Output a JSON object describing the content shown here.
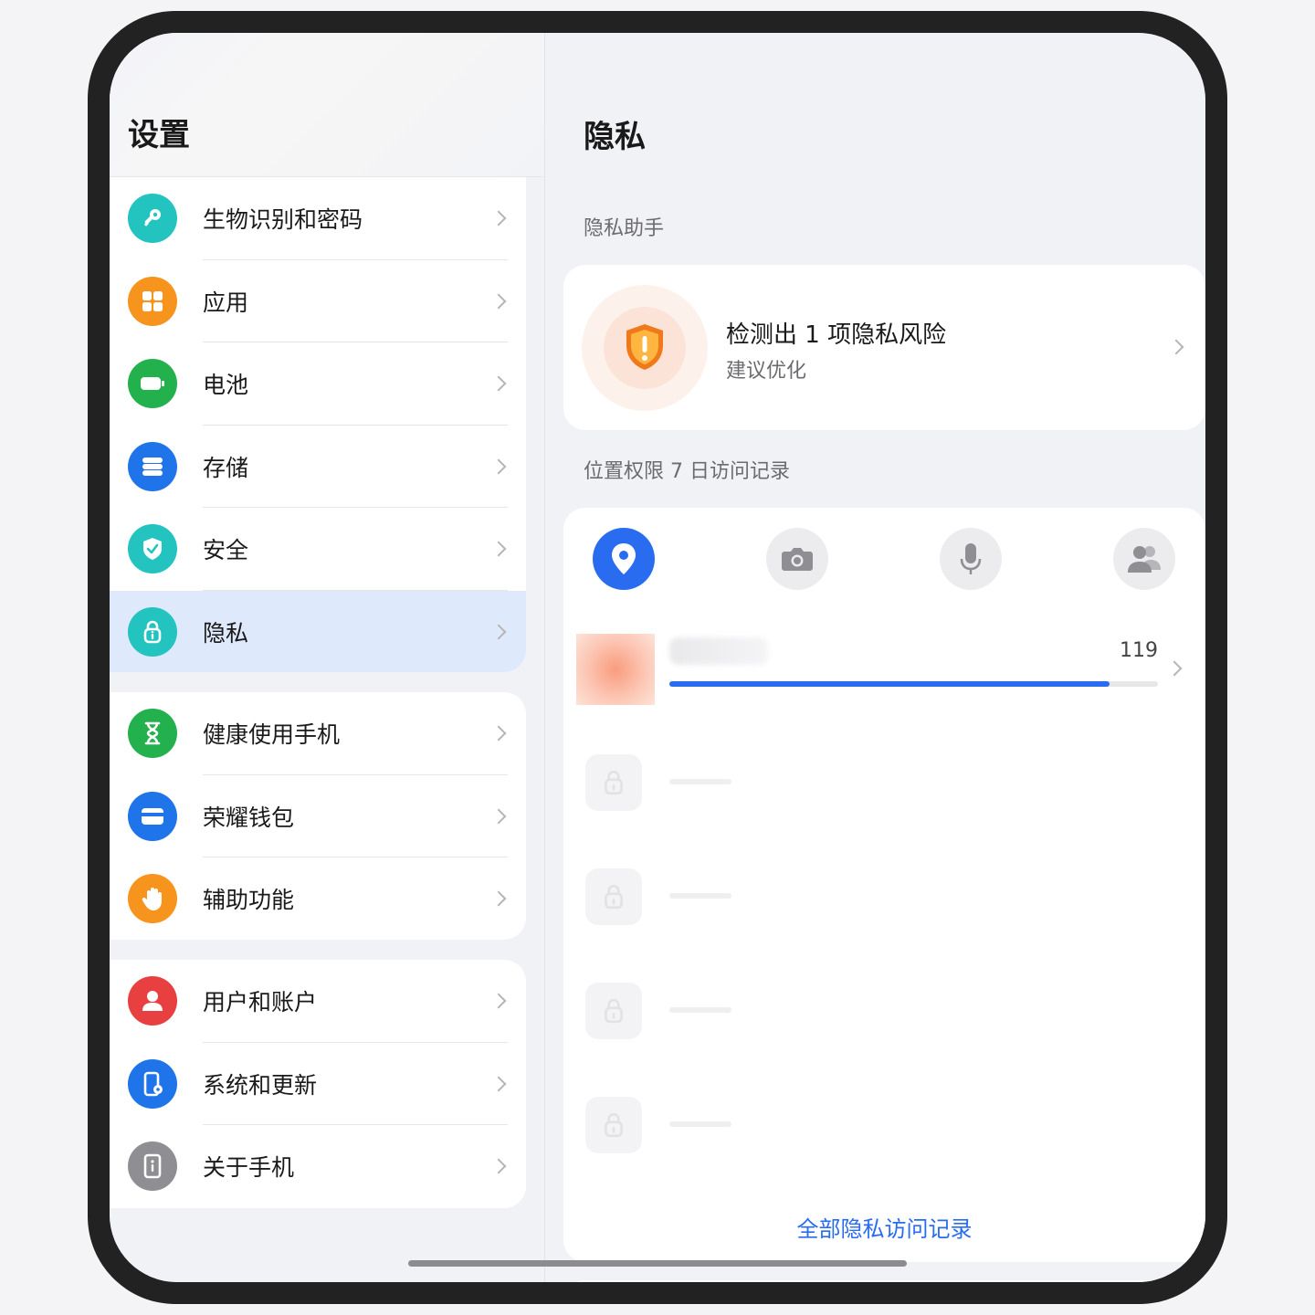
{
  "left": {
    "title": "设置",
    "group1": [
      {
        "label": "生物识别和密码",
        "icon": "key-icon",
        "color": "#23c3c0"
      },
      {
        "label": "应用",
        "icon": "apps-grid-icon",
        "color": "#f7941d"
      },
      {
        "label": "电池",
        "icon": "battery-icon",
        "color": "#22b14c"
      },
      {
        "label": "存储",
        "icon": "storage-icon",
        "color": "#1e74e8"
      },
      {
        "label": "安全",
        "icon": "shield-check-icon",
        "color": "#23c3c0"
      },
      {
        "label": "隐私",
        "icon": "privacy-lock-icon",
        "color": "#23c3c0",
        "selected": true
      }
    ],
    "group2": [
      {
        "label": "健康使用手机",
        "icon": "hourglass-icon",
        "color": "#22b14c"
      },
      {
        "label": "荣耀钱包",
        "icon": "wallet-icon",
        "color": "#1e74e8"
      },
      {
        "label": "辅助功能",
        "icon": "hand-icon",
        "color": "#f7941d"
      }
    ],
    "group3": [
      {
        "label": "用户和账户",
        "icon": "user-icon",
        "color": "#e84040"
      },
      {
        "label": "系统和更新",
        "icon": "phone-gear-icon",
        "color": "#1e74e8"
      },
      {
        "label": "关于手机",
        "icon": "info-phone-icon",
        "color": "#8e8e93"
      }
    ]
  },
  "right": {
    "title": "隐私",
    "assistant_label": "隐私助手",
    "risk": {
      "title": "检测出 1 项隐私风险",
      "subtitle": "建议优化",
      "icon": "warning-shield-icon",
      "color": "#f07a1a"
    },
    "location_label": "位置权限 7 日访问记录",
    "tabs": [
      {
        "icon": "location-pin-icon",
        "active": true
      },
      {
        "icon": "camera-icon",
        "active": false
      },
      {
        "icon": "microphone-icon",
        "active": false
      },
      {
        "icon": "contacts-icon",
        "active": false
      }
    ],
    "top_app": {
      "count": "119",
      "fraction": 0.9
    },
    "all_records_link": "全部隐私访问记录"
  },
  "colors": {
    "accent": "#2a6cf0",
    "selected_bg": "#dfe9fc"
  }
}
